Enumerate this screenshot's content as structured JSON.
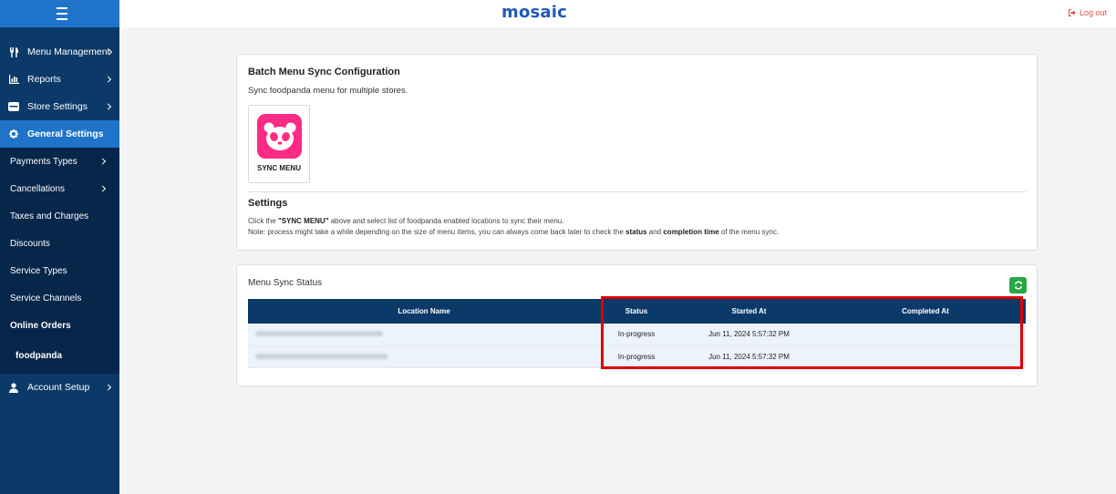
{
  "app": {
    "brand": "mosaic",
    "logout_label": "Log out"
  },
  "sidebar": {
    "items": [
      {
        "label": "Menu Management",
        "icon": "utensils-icon"
      },
      {
        "label": "Reports",
        "icon": "bar-chart-icon"
      },
      {
        "label": "Store Settings",
        "icon": "store-icon"
      },
      {
        "label": "General Settings",
        "icon": "gear-icon"
      }
    ],
    "sub_items": [
      {
        "label": "Payments Types"
      },
      {
        "label": "Cancellations"
      },
      {
        "label": "Taxes and Charges"
      },
      {
        "label": "Discounts"
      },
      {
        "label": "Service Types"
      },
      {
        "label": "Service Channels"
      },
      {
        "label": "Online Orders"
      },
      {
        "label": "foodpanda"
      }
    ],
    "account": {
      "label": "Account Setup",
      "icon": "user-icon"
    }
  },
  "config_card": {
    "title": "Batch Menu Sync Configuration",
    "description": "Sync foodpanda menu for multiple stores.",
    "sync_label": "SYNC MENU",
    "settings_title": "Settings",
    "settings_line1_prefix": "Click the ",
    "settings_line1_bold": "\"SYNC MENU\"",
    "settings_line1_suffix": " above and select list of foodpanda enabled locations to sync their menu.",
    "settings_line2_prefix": "Note: process might take a while depending on the size of menu items, you can always come back later to check the ",
    "settings_line2_bold1": "status",
    "settings_line2_mid": " and ",
    "settings_line2_bold2": "completion time",
    "settings_line2_suffix": " of the menu sync."
  },
  "status_card": {
    "title": "Menu Sync Status",
    "columns": [
      "Location Name",
      "Status",
      "Started At",
      "Completed At"
    ],
    "rows": [
      {
        "status": "In-progress",
        "started_at": "Jun 11, 2024 5:57:32 PM",
        "completed_at": ""
      },
      {
        "status": "In-progress",
        "started_at": "Jun 11, 2024 5:57:32 PM",
        "completed_at": ""
      }
    ]
  },
  "colors": {
    "sidebar_bg": "#0b3a68",
    "accent": "#1f74c9",
    "foodpanda_pink": "#ff2b85",
    "highlight": "#e00000",
    "refresh_green": "#28a745"
  }
}
